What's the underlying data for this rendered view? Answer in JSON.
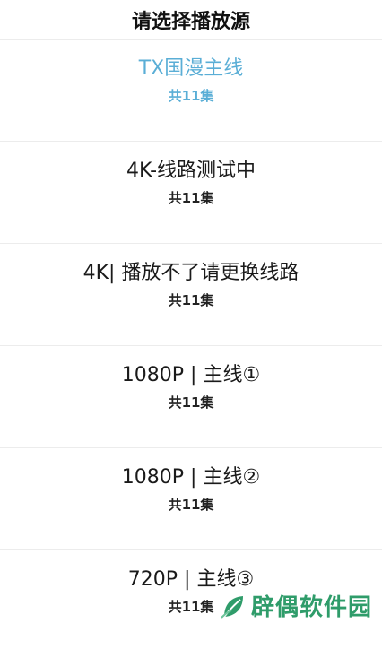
{
  "header": {
    "title": "请选择播放源"
  },
  "sources": [
    {
      "name": "TX国漫主线",
      "count": "共11集",
      "active": true
    },
    {
      "name": "4K-线路测试中",
      "count": "共11集",
      "active": false
    },
    {
      "name": "4K| 播放不了请更换线路",
      "count": "共11集",
      "active": false
    },
    {
      "name": "1080P | 主线①",
      "count": "共11集",
      "active": false
    },
    {
      "name": "1080P | 主线②",
      "count": "共11集",
      "active": false
    },
    {
      "name": "720P | 主线③",
      "count": "共11集",
      "active": false
    }
  ],
  "colors": {
    "active": "#5aaed6",
    "text": "#1a1a1a",
    "divider": "#ececec",
    "watermark": "#2f9c6a"
  },
  "watermark": {
    "text": "辟偶软件园",
    "icon": "leaf-logo-icon"
  }
}
